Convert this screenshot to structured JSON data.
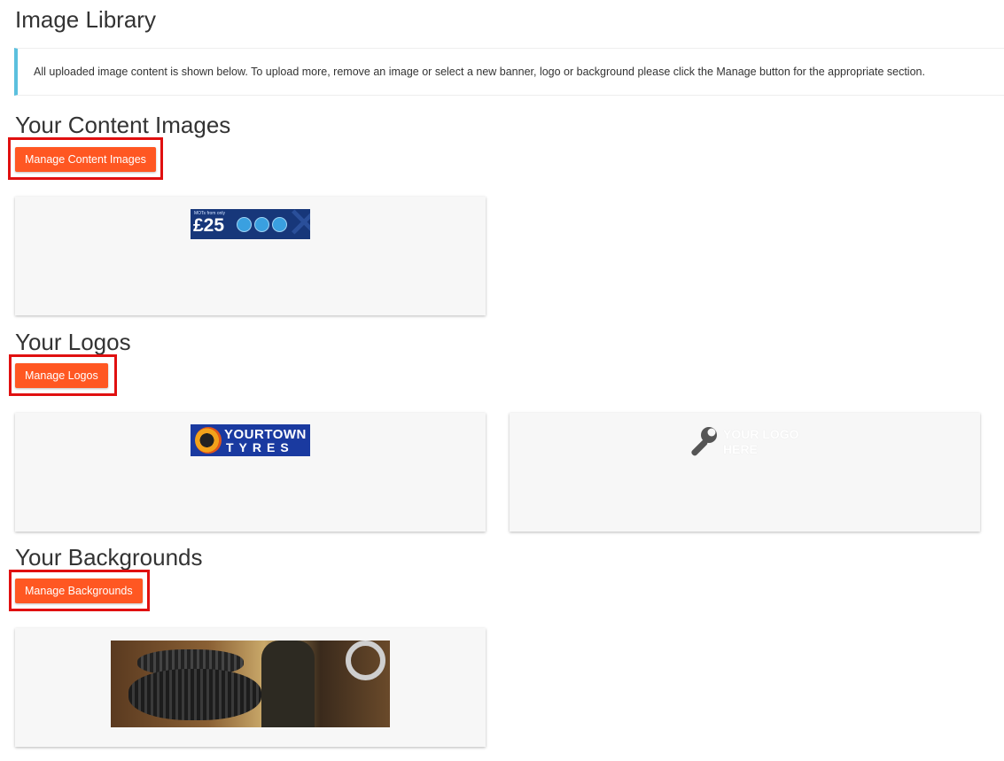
{
  "page": {
    "title": "Image Library",
    "info_text": "All uploaded image content is shown below. To upload more, remove an image or select a new banner, logo or background please click the Manage button for the appropriate section."
  },
  "sections": {
    "content": {
      "title": "Your Content Images",
      "button_label": "Manage Content Images",
      "images": [
        {
          "name": "mot-banner",
          "small_text": "MOTs from only",
          "price": "£25"
        }
      ]
    },
    "logos": {
      "title": "Your Logos",
      "button_label": "Manage Logos",
      "images": [
        {
          "name": "yourtown-tyres-logo",
          "line1": "YOURTOWN",
          "line2": "TYRES"
        },
        {
          "name": "your-logo-here-placeholder",
          "line1": "YOUR LOGO",
          "line2": "HERE"
        }
      ]
    },
    "backgrounds": {
      "title": "Your Backgrounds",
      "button_label": "Manage Backgrounds",
      "images": [
        {
          "name": "tyre-workshop-photo"
        }
      ]
    }
  },
  "colors": {
    "accent_button": "#ff5722",
    "highlight_box": "#e01010",
    "info_border": "#5bc0de",
    "card_background": "#f7f7f7"
  }
}
